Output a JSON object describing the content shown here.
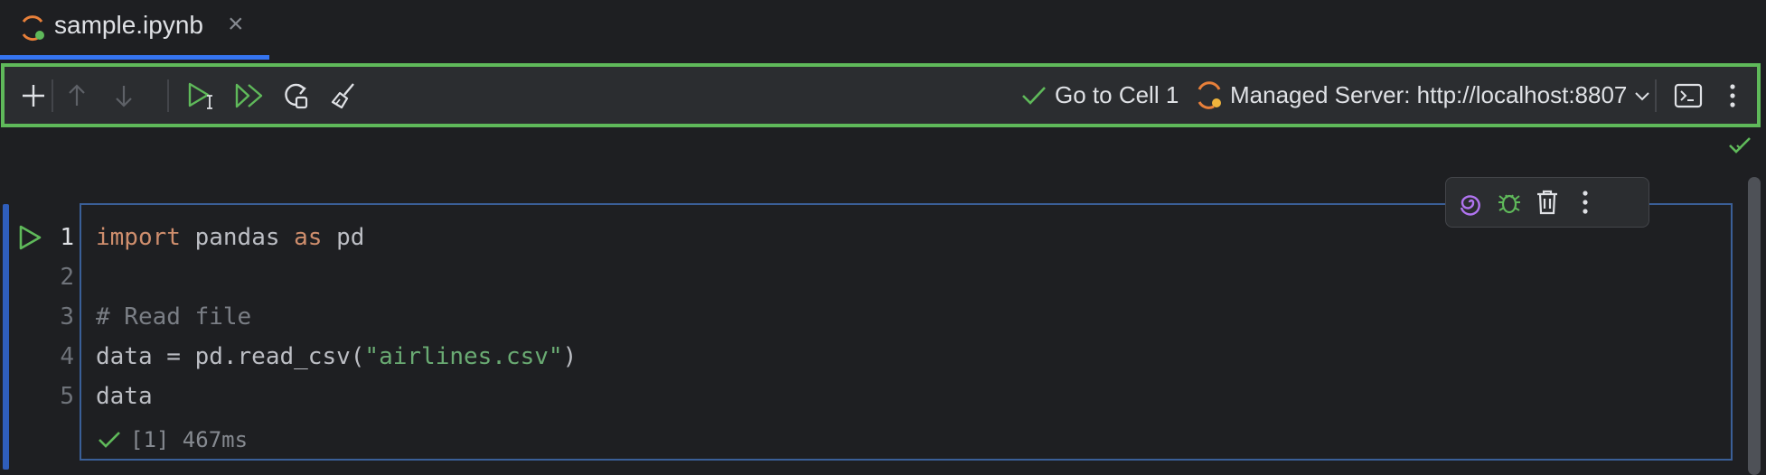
{
  "tab": {
    "label": "sample.ipynb",
    "close_icon": "close-icon",
    "icon": "jupyter-icon"
  },
  "toolbar": {
    "go_to_cell": "Go to Cell 1",
    "server": "Managed Server: http://localhost:8807",
    "icons": [
      "add-icon",
      "move-up-icon",
      "move-down-icon",
      "run-cell-icon",
      "run-all-icon",
      "restart-kernel-icon",
      "clear-outputs-icon",
      "terminal-icon",
      "more-icon"
    ]
  },
  "cell": {
    "line_numbers": [
      "1",
      "2",
      "3",
      "4",
      "5"
    ],
    "code": {
      "l1_kw1": "import",
      "l1_mid": " pandas ",
      "l1_kw2": "as",
      "l1_end": " pd",
      "l3": "# Read file",
      "l4_a": "data = pd.read_csv(",
      "l4_str": "\"airlines.csv\"",
      "l4_b": ")",
      "l5": "data"
    },
    "exec_status": "[1] 467ms"
  },
  "colors": {
    "accent": "#3574f0",
    "toolbar_border": "#5fb95a",
    "success": "#5fb95a"
  }
}
